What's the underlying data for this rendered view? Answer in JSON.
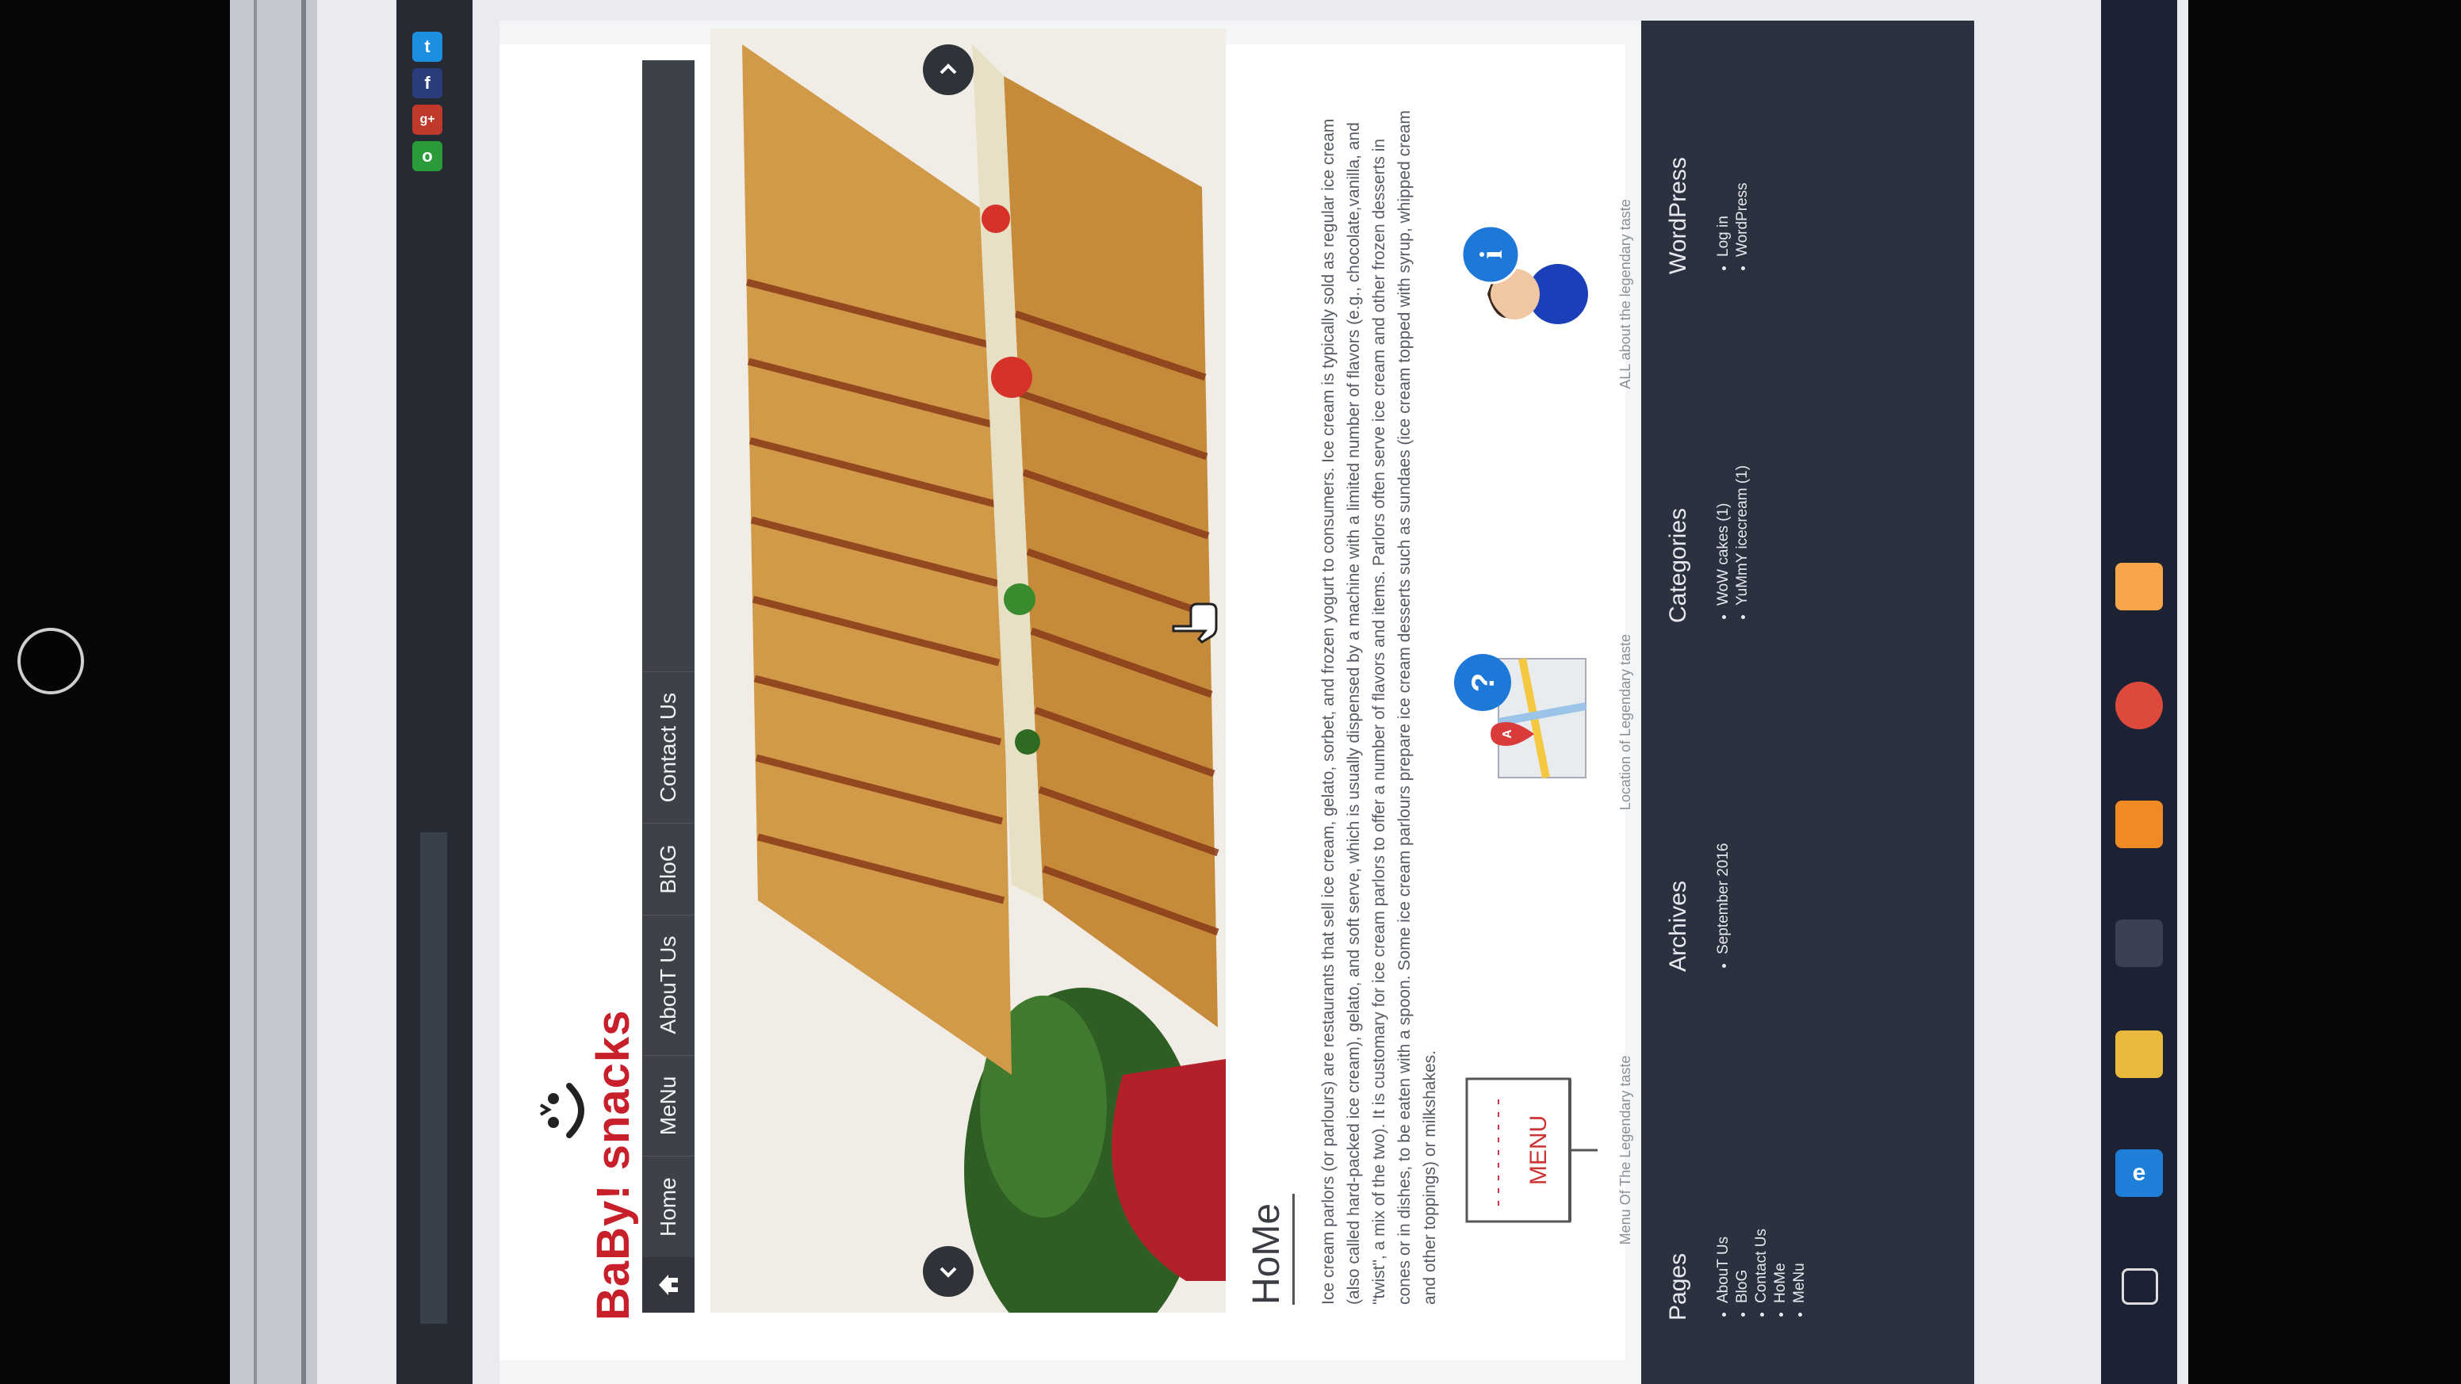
{
  "site": {
    "logo_text": "BaBy! snacks"
  },
  "social": [
    {
      "icon": "twitter-icon",
      "glyph": "t",
      "color": "#1d8fe0"
    },
    {
      "icon": "facebook-icon",
      "glyph": "f",
      "color": "#2a3d7a"
    },
    {
      "icon": "google-plus-icon",
      "glyph": "g+",
      "color": "#c0392b"
    },
    {
      "icon": "rss-icon",
      "glyph": "o",
      "color": "#2b9a3a"
    }
  ],
  "nav": {
    "home_icon": "home-icon",
    "items": [
      "Home",
      "MeNu",
      "AbouT Us",
      "BloG",
      "Contact Us"
    ]
  },
  "home": {
    "title": "HoMe",
    "body": "Ice cream parlors (or parlours) are restaurants that sell ice cream, gelato, sorbet, and frozen yogurt to consumers. Ice cream is typically sold as regular ice cream (also called hard-packed ice cream), gelato, and soft serve, which is usually dispensed by a machine with a limited number of flavors (e.g., chocolate,vanilla, and \"twist\", a mix of the two). It is customary for ice cream parlors to offer a number of flavors and items. Parlors often serve ice cream and other frozen desserts in cones or in dishes, to be eaten with a spoon. Some ice cream parlours prepare ice cream desserts such as sundaes (ice cream topped with syrup, whipped cream and other toppings) or milkshakes."
  },
  "blocks": [
    {
      "caption": "Menu Of The Legendary taste",
      "icon": "menu-board-icon",
      "label": "MENU"
    },
    {
      "caption": "Location of Legendary taste",
      "icon": "map-location-icon"
    },
    {
      "caption": "ALL about the legendary taste",
      "icon": "info-person-icon"
    }
  ],
  "footer": {
    "pages": {
      "title": "Pages",
      "items": [
        "AbouT Us",
        "BloG",
        "Contact Us",
        "HoMe",
        "MeNu"
      ]
    },
    "archives": {
      "title": "Archives",
      "items": [
        "September 2016"
      ]
    },
    "categories": {
      "title": "Categories",
      "items": [
        "WoW cakes (1)",
        "YuMmY icecream (1)"
      ]
    },
    "wordpress": {
      "title": "WordPress",
      "items": [
        "Log in",
        "WordPress"
      ]
    }
  },
  "taskbar": [
    {
      "icon": "task-view-icon",
      "color": "#1c2233"
    },
    {
      "icon": "edge-browser-icon",
      "color": "#1e7fd8"
    },
    {
      "icon": "file-explorer-icon",
      "color": "#e8b93a"
    },
    {
      "icon": "store-icon",
      "color": "#1c2233"
    },
    {
      "icon": "vlc-icon",
      "color": "#f08a24"
    },
    {
      "icon": "chrome-icon",
      "color": "#dd4a3c"
    },
    {
      "icon": "xampp-icon",
      "color": "#f7a64a"
    }
  ]
}
